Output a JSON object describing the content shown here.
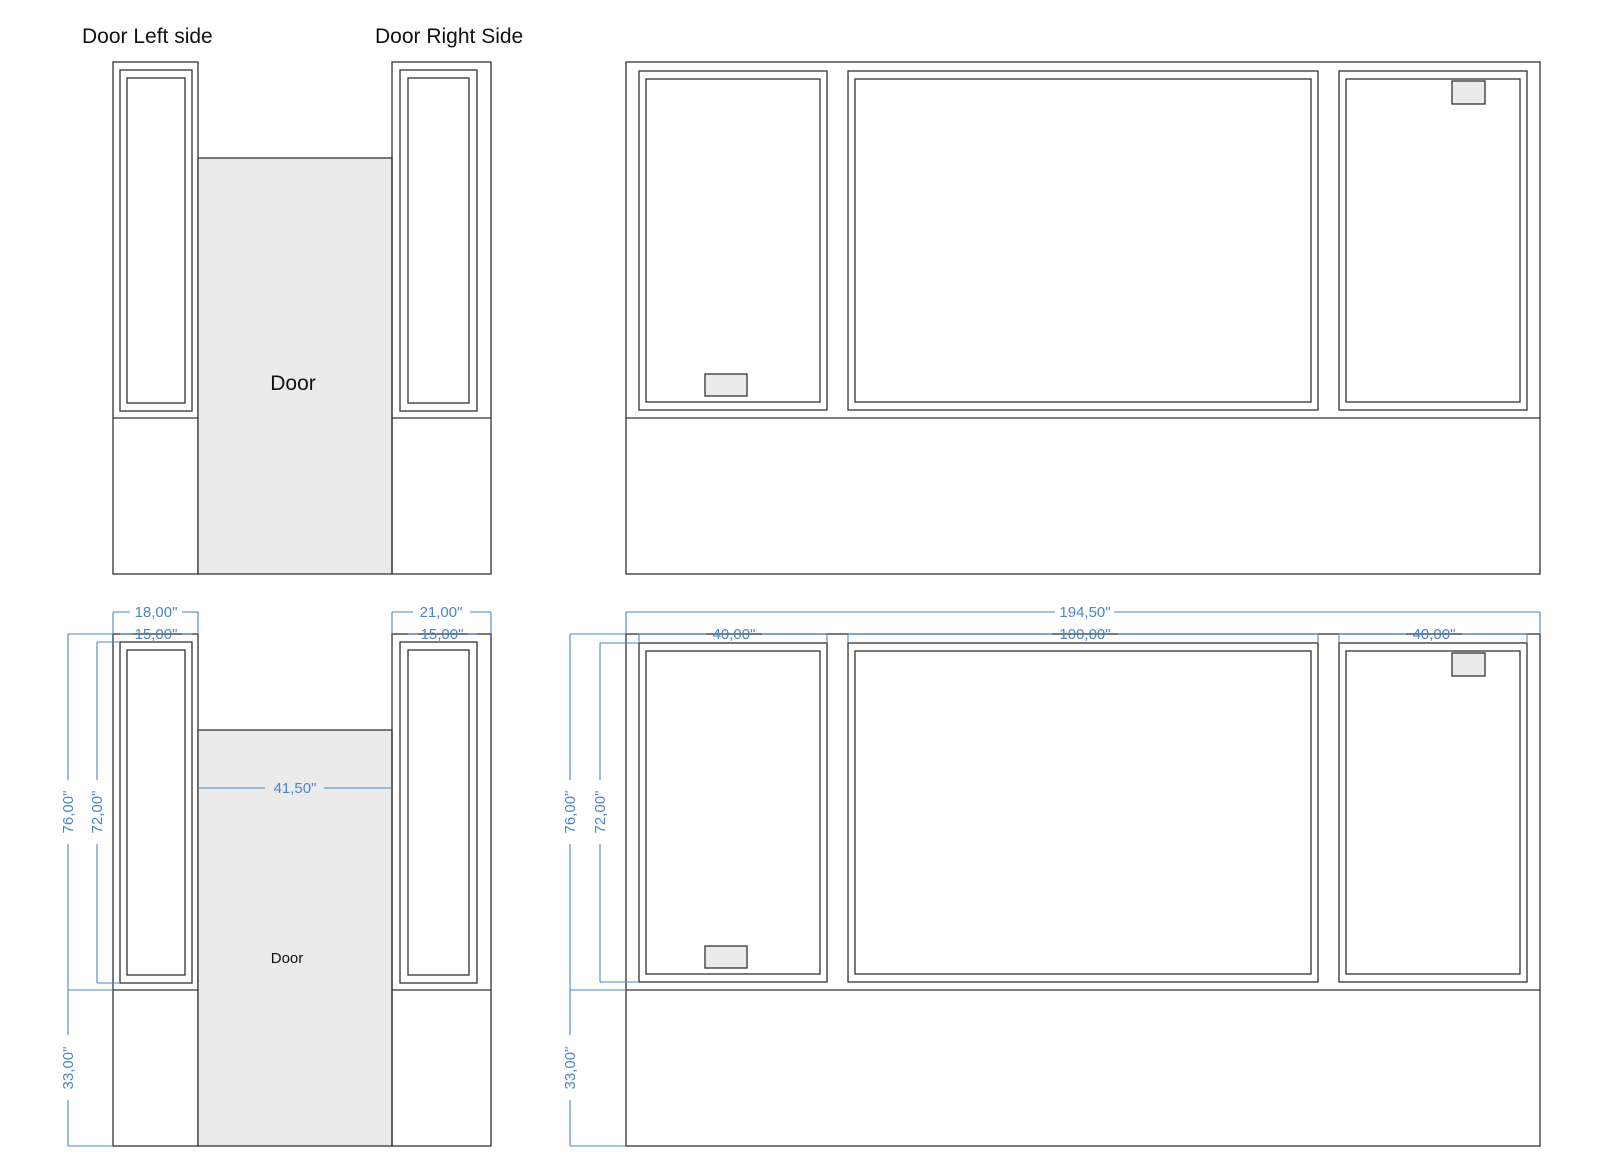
{
  "labels": {
    "door_left_side": "Door  Left side",
    "door_right_side": "Door Right Side",
    "door_top": "Door",
    "door_bottom": "Door"
  },
  "dimensions": {
    "left_side_outer_width": "18,00\"",
    "left_side_inner_width": "15,00\"",
    "right_side_outer_width": "21,00\"",
    "right_side_inner_width": "15,00\"",
    "door_width": "41,50\"",
    "left_total_height": "76,00\"",
    "left_inner_height": "72,00\"",
    "left_base_height": "33,00\"",
    "window_total_width": "194,50\"",
    "window_left_width": "40,00\"",
    "window_center_width": "100,00\"",
    "window_right_width": "40,00\"",
    "right_total_height": "76,00\"",
    "right_inner_height": "72,00\"",
    "right_base_height": "33,00\""
  },
  "colors": {
    "line": "#333333",
    "dimension": "#4a86c5",
    "panel_fill": "#ebebeb"
  }
}
